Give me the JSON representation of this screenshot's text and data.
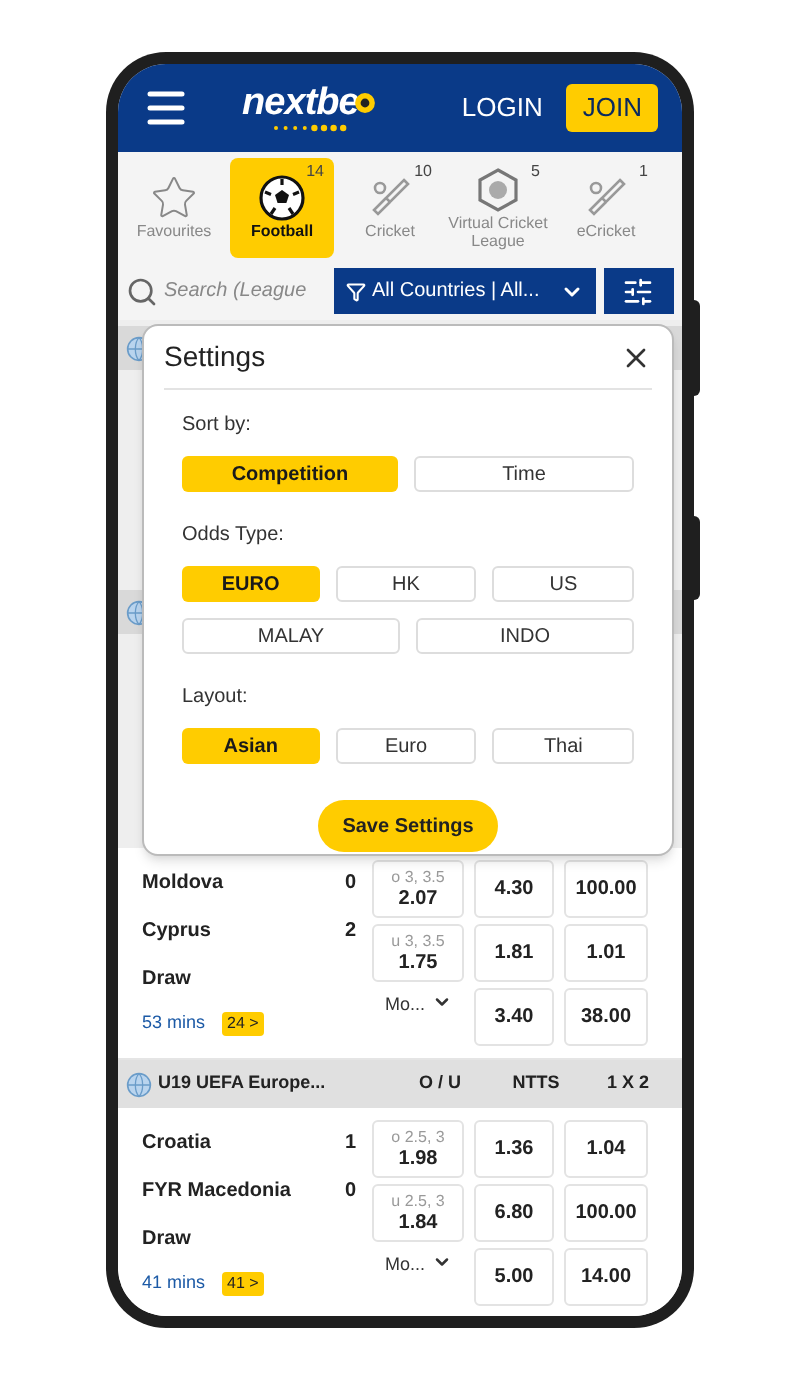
{
  "header": {
    "logo": "nextbe",
    "login": "LOGIN",
    "join": "JOIN"
  },
  "sports": [
    {
      "label": "Favourites",
      "selected": false,
      "kind": "favourites"
    },
    {
      "label": "Football",
      "count": "14",
      "selected": true,
      "kind": "football"
    },
    {
      "label": "Cricket",
      "count": "10",
      "selected": false,
      "kind": "cricket"
    },
    {
      "label": "Virtual Cricket League",
      "count": "5",
      "selected": false,
      "kind": "virtual"
    },
    {
      "label": "eCricket",
      "count": "1",
      "selected": false,
      "kind": "cricket"
    }
  ],
  "search": {
    "placeholder": "Search (League"
  },
  "filter": {
    "label": "All Countries | All..."
  },
  "settings": {
    "title": "Settings",
    "groups": [
      {
        "label": "Sort by:",
        "rows": [
          [
            {
              "label": "Competition",
              "selected": true
            },
            {
              "label": "Time",
              "selected": false
            }
          ]
        ]
      },
      {
        "label": "Odds Type:",
        "rows": [
          [
            {
              "label": "EURO",
              "selected": true
            },
            {
              "label": "HK",
              "selected": false
            },
            {
              "label": "US",
              "selected": false
            }
          ],
          [
            {
              "label": "MALAY",
              "selected": false
            },
            {
              "label": "INDO",
              "selected": false
            }
          ]
        ]
      },
      {
        "label": "Layout:",
        "rows": [
          [
            {
              "label": "Asian",
              "selected": true
            },
            {
              "label": "Euro",
              "selected": false
            },
            {
              "label": "Thai",
              "selected": false
            }
          ]
        ]
      }
    ],
    "save": "Save Settings"
  },
  "events": [
    {
      "kind": "match",
      "teams": [
        {
          "name": "Moldova",
          "score": "0"
        },
        {
          "name": "Cyprus",
          "score": "2"
        }
      ],
      "draw": "Draw",
      "time": "53 mins",
      "more_markets": "24 >",
      "ou": [
        {
          "line": "o 3, 3.5",
          "odd": "2.07"
        },
        {
          "line": "u 3, 3.5",
          "odd": "1.75"
        }
      ],
      "ou_more": "Mo...",
      "ntts": [
        "4.30",
        "1.81",
        "3.40"
      ],
      "x12": [
        "100.00",
        "1.01",
        "38.00"
      ]
    },
    {
      "kind": "league",
      "name": "U19 UEFA Europe...",
      "columns": [
        "O / U",
        "NTTS",
        "1 X 2"
      ]
    },
    {
      "kind": "match",
      "teams": [
        {
          "name": "Croatia",
          "score": "1"
        },
        {
          "name": "FYR Macedonia",
          "score": "0"
        }
      ],
      "draw": "Draw",
      "time": "41 mins",
      "more_markets": "41 >",
      "ou": [
        {
          "line": "o 2.5, 3",
          "odd": "1.98"
        },
        {
          "line": "u 2.5, 3",
          "odd": "1.84"
        }
      ],
      "ou_more": "Mo...",
      "ntts": [
        "1.36",
        "6.80",
        "5.00"
      ],
      "x12": [
        "1.04",
        "100.00",
        "14.00"
      ]
    }
  ]
}
